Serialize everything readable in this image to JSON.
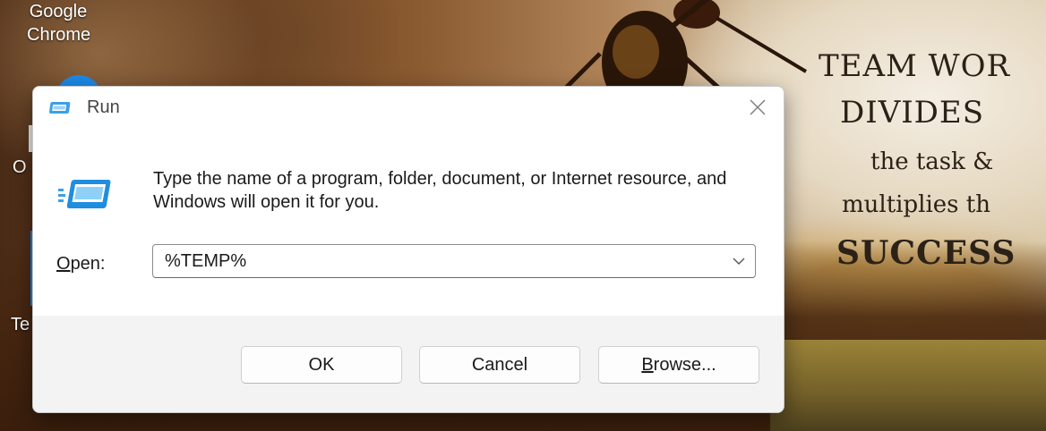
{
  "desktop": {
    "icons": [
      {
        "label_line1": "Google",
        "label_line2": "Chrome"
      },
      {
        "label": "O"
      },
      {
        "label": "Te"
      }
    ],
    "wallpaper_text": {
      "line1": "TEAM WOR",
      "line2": "DIVIDES",
      "line3": "the task &",
      "line4": "multiplies th",
      "line5": "SUCCESS"
    }
  },
  "dialog": {
    "title": "Run",
    "description": "Type the name of a program, folder, document, or Internet resource, and Windows will open it for you.",
    "open_label_underlined": "O",
    "open_label_rest": "pen:",
    "open_value": "%TEMP%",
    "buttons": {
      "ok": "OK",
      "cancel": "Cancel",
      "browse_underlined": "B",
      "browse_rest": "rowse..."
    }
  },
  "icons": {
    "title": "run-icon",
    "body": "run-icon",
    "close": "close-icon",
    "dropdown": "chevron-down-icon"
  },
  "colors": {
    "accent": "#1e88e5",
    "dialog_bg": "#ffffff",
    "footer_bg": "#f3f3f3"
  }
}
